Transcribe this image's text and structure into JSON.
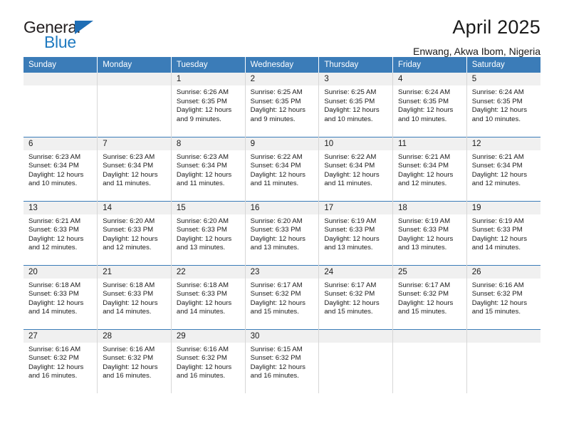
{
  "brand": {
    "name_top": "General",
    "name_bottom": "Blue",
    "accent_color": "#1f7ac0",
    "triangle_color": "#1f6eb5"
  },
  "header": {
    "title": "April 2025",
    "subtitle": "Enwang, Akwa Ibom, Nigeria"
  },
  "theme": {
    "header_row_bg": "#3b7cb8",
    "daynum_bg": "#f0f0f0",
    "grid_line": "#d7d7d7",
    "row_line": "#3b7cb8",
    "text": "#1a1a1a"
  },
  "weekdays": [
    "Sunday",
    "Monday",
    "Tuesday",
    "Wednesday",
    "Thursday",
    "Friday",
    "Saturday"
  ],
  "weeks": [
    [
      {
        "day": "",
        "lines": []
      },
      {
        "day": "",
        "lines": []
      },
      {
        "day": "1",
        "lines": [
          "Sunrise: 6:26 AM",
          "Sunset: 6:35 PM",
          "Daylight: 12 hours",
          "and 9 minutes."
        ]
      },
      {
        "day": "2",
        "lines": [
          "Sunrise: 6:25 AM",
          "Sunset: 6:35 PM",
          "Daylight: 12 hours",
          "and 9 minutes."
        ]
      },
      {
        "day": "3",
        "lines": [
          "Sunrise: 6:25 AM",
          "Sunset: 6:35 PM",
          "Daylight: 12 hours",
          "and 10 minutes."
        ]
      },
      {
        "day": "4",
        "lines": [
          "Sunrise: 6:24 AM",
          "Sunset: 6:35 PM",
          "Daylight: 12 hours",
          "and 10 minutes."
        ]
      },
      {
        "day": "5",
        "lines": [
          "Sunrise: 6:24 AM",
          "Sunset: 6:35 PM",
          "Daylight: 12 hours",
          "and 10 minutes."
        ]
      }
    ],
    [
      {
        "day": "6",
        "lines": [
          "Sunrise: 6:23 AM",
          "Sunset: 6:34 PM",
          "Daylight: 12 hours",
          "and 10 minutes."
        ]
      },
      {
        "day": "7",
        "lines": [
          "Sunrise: 6:23 AM",
          "Sunset: 6:34 PM",
          "Daylight: 12 hours",
          "and 11 minutes."
        ]
      },
      {
        "day": "8",
        "lines": [
          "Sunrise: 6:23 AM",
          "Sunset: 6:34 PM",
          "Daylight: 12 hours",
          "and 11 minutes."
        ]
      },
      {
        "day": "9",
        "lines": [
          "Sunrise: 6:22 AM",
          "Sunset: 6:34 PM",
          "Daylight: 12 hours",
          "and 11 minutes."
        ]
      },
      {
        "day": "10",
        "lines": [
          "Sunrise: 6:22 AM",
          "Sunset: 6:34 PM",
          "Daylight: 12 hours",
          "and 11 minutes."
        ]
      },
      {
        "day": "11",
        "lines": [
          "Sunrise: 6:21 AM",
          "Sunset: 6:34 PM",
          "Daylight: 12 hours",
          "and 12 minutes."
        ]
      },
      {
        "day": "12",
        "lines": [
          "Sunrise: 6:21 AM",
          "Sunset: 6:34 PM",
          "Daylight: 12 hours",
          "and 12 minutes."
        ]
      }
    ],
    [
      {
        "day": "13",
        "lines": [
          "Sunrise: 6:21 AM",
          "Sunset: 6:33 PM",
          "Daylight: 12 hours",
          "and 12 minutes."
        ]
      },
      {
        "day": "14",
        "lines": [
          "Sunrise: 6:20 AM",
          "Sunset: 6:33 PM",
          "Daylight: 12 hours",
          "and 12 minutes."
        ]
      },
      {
        "day": "15",
        "lines": [
          "Sunrise: 6:20 AM",
          "Sunset: 6:33 PM",
          "Daylight: 12 hours",
          "and 13 minutes."
        ]
      },
      {
        "day": "16",
        "lines": [
          "Sunrise: 6:20 AM",
          "Sunset: 6:33 PM",
          "Daylight: 12 hours",
          "and 13 minutes."
        ]
      },
      {
        "day": "17",
        "lines": [
          "Sunrise: 6:19 AM",
          "Sunset: 6:33 PM",
          "Daylight: 12 hours",
          "and 13 minutes."
        ]
      },
      {
        "day": "18",
        "lines": [
          "Sunrise: 6:19 AM",
          "Sunset: 6:33 PM",
          "Daylight: 12 hours",
          "and 13 minutes."
        ]
      },
      {
        "day": "19",
        "lines": [
          "Sunrise: 6:19 AM",
          "Sunset: 6:33 PM",
          "Daylight: 12 hours",
          "and 14 minutes."
        ]
      }
    ],
    [
      {
        "day": "20",
        "lines": [
          "Sunrise: 6:18 AM",
          "Sunset: 6:33 PM",
          "Daylight: 12 hours",
          "and 14 minutes."
        ]
      },
      {
        "day": "21",
        "lines": [
          "Sunrise: 6:18 AM",
          "Sunset: 6:33 PM",
          "Daylight: 12 hours",
          "and 14 minutes."
        ]
      },
      {
        "day": "22",
        "lines": [
          "Sunrise: 6:18 AM",
          "Sunset: 6:33 PM",
          "Daylight: 12 hours",
          "and 14 minutes."
        ]
      },
      {
        "day": "23",
        "lines": [
          "Sunrise: 6:17 AM",
          "Sunset: 6:32 PM",
          "Daylight: 12 hours",
          "and 15 minutes."
        ]
      },
      {
        "day": "24",
        "lines": [
          "Sunrise: 6:17 AM",
          "Sunset: 6:32 PM",
          "Daylight: 12 hours",
          "and 15 minutes."
        ]
      },
      {
        "day": "25",
        "lines": [
          "Sunrise: 6:17 AM",
          "Sunset: 6:32 PM",
          "Daylight: 12 hours",
          "and 15 minutes."
        ]
      },
      {
        "day": "26",
        "lines": [
          "Sunrise: 6:16 AM",
          "Sunset: 6:32 PM",
          "Daylight: 12 hours",
          "and 15 minutes."
        ]
      }
    ],
    [
      {
        "day": "27",
        "lines": [
          "Sunrise: 6:16 AM",
          "Sunset: 6:32 PM",
          "Daylight: 12 hours",
          "and 16 minutes."
        ]
      },
      {
        "day": "28",
        "lines": [
          "Sunrise: 6:16 AM",
          "Sunset: 6:32 PM",
          "Daylight: 12 hours",
          "and 16 minutes."
        ]
      },
      {
        "day": "29",
        "lines": [
          "Sunrise: 6:16 AM",
          "Sunset: 6:32 PM",
          "Daylight: 12 hours",
          "and 16 minutes."
        ]
      },
      {
        "day": "30",
        "lines": [
          "Sunrise: 6:15 AM",
          "Sunset: 6:32 PM",
          "Daylight: 12 hours",
          "and 16 minutes."
        ]
      },
      {
        "day": "",
        "lines": []
      },
      {
        "day": "",
        "lines": []
      },
      {
        "day": "",
        "lines": []
      }
    ]
  ]
}
